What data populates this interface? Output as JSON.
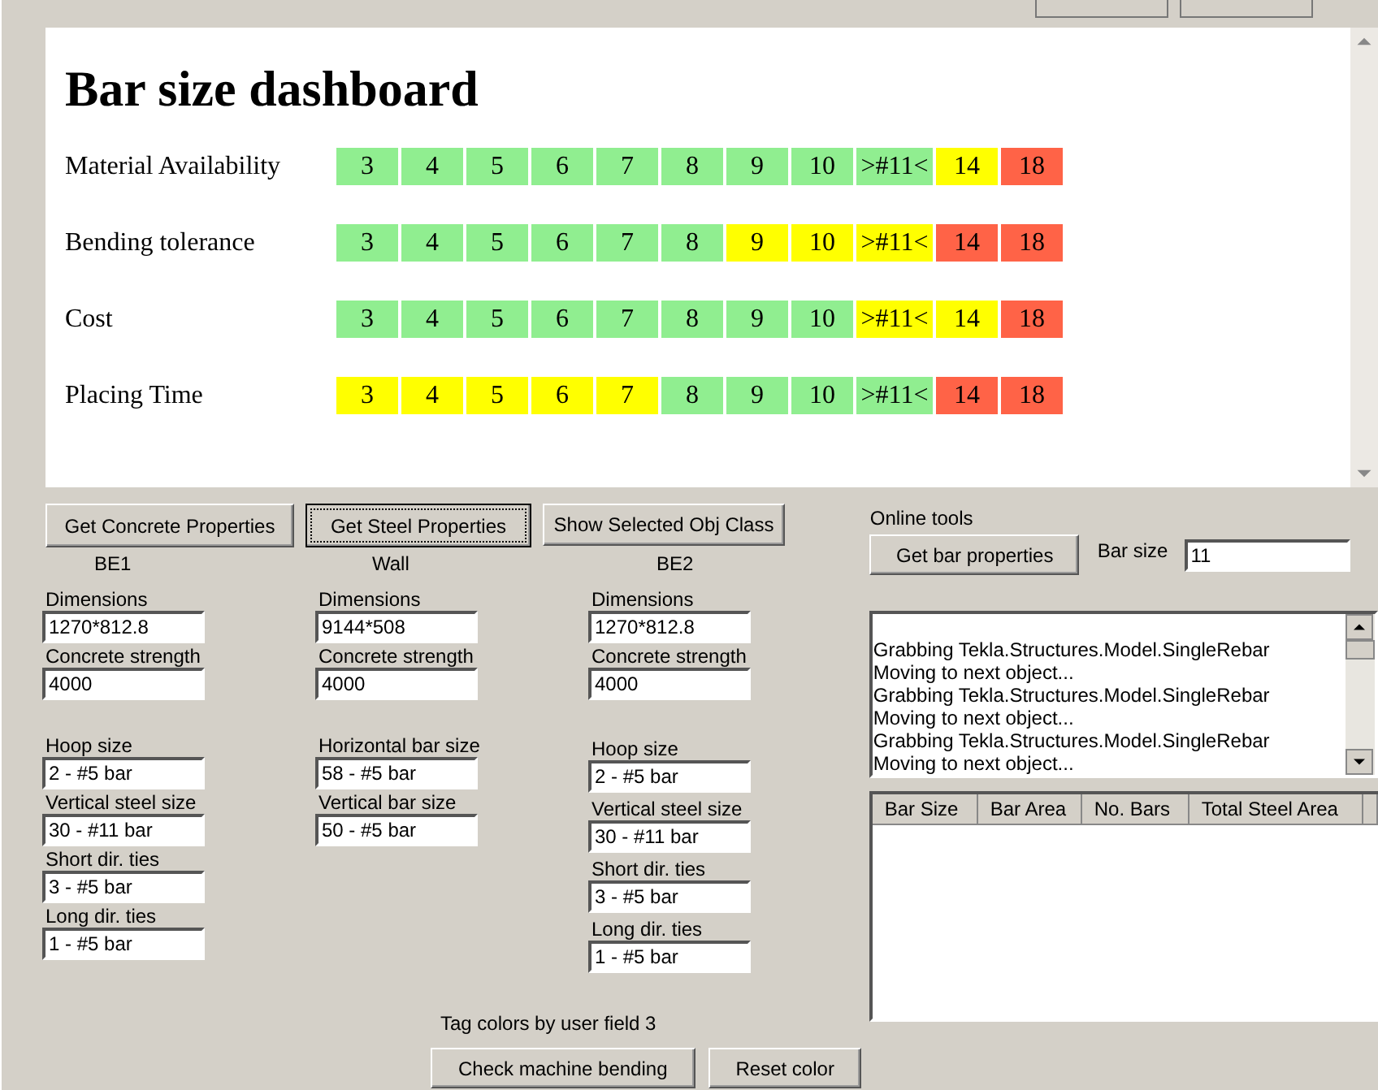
{
  "dashboard": {
    "title": "Bar size dashboard",
    "rows": [
      {
        "label": "Material Availability",
        "cells": [
          {
            "text": "3",
            "color": "#90ee90"
          },
          {
            "text": "4",
            "color": "#90ee90"
          },
          {
            "text": "5",
            "color": "#90ee90"
          },
          {
            "text": "6",
            "color": "#90ee90"
          },
          {
            "text": "7",
            "color": "#90ee90"
          },
          {
            "text": "8",
            "color": "#90ee90"
          },
          {
            "text": "9",
            "color": "#90ee90"
          },
          {
            "text": "10",
            "color": "#90ee90"
          },
          {
            "text": ">#11<",
            "color": "#90ee90"
          },
          {
            "text": "14",
            "color": "#ffff00"
          },
          {
            "text": "18",
            "color": "#ff6347"
          }
        ]
      },
      {
        "label": "Bending tolerance",
        "cells": [
          {
            "text": "3",
            "color": "#90ee90"
          },
          {
            "text": "4",
            "color": "#90ee90"
          },
          {
            "text": "5",
            "color": "#90ee90"
          },
          {
            "text": "6",
            "color": "#90ee90"
          },
          {
            "text": "7",
            "color": "#90ee90"
          },
          {
            "text": "8",
            "color": "#90ee90"
          },
          {
            "text": "9",
            "color": "#ffff00"
          },
          {
            "text": "10",
            "color": "#ffff00"
          },
          {
            "text": ">#11<",
            "color": "#ffff00"
          },
          {
            "text": "14",
            "color": "#ff6347"
          },
          {
            "text": "18",
            "color": "#ff6347"
          }
        ]
      },
      {
        "label": "Cost",
        "cells": [
          {
            "text": "3",
            "color": "#90ee90"
          },
          {
            "text": "4",
            "color": "#90ee90"
          },
          {
            "text": "5",
            "color": "#90ee90"
          },
          {
            "text": "6",
            "color": "#90ee90"
          },
          {
            "text": "7",
            "color": "#90ee90"
          },
          {
            "text": "8",
            "color": "#90ee90"
          },
          {
            "text": "9",
            "color": "#90ee90"
          },
          {
            "text": "10",
            "color": "#90ee90"
          },
          {
            "text": ">#11<",
            "color": "#ffff00"
          },
          {
            "text": "14",
            "color": "#ffff00"
          },
          {
            "text": "18",
            "color": "#ff6347"
          }
        ]
      },
      {
        "label": "Placing Time",
        "cells": [
          {
            "text": "3",
            "color": "#ffff00"
          },
          {
            "text": "4",
            "color": "#ffff00"
          },
          {
            "text": "5",
            "color": "#ffff00"
          },
          {
            "text": "6",
            "color": "#ffff00"
          },
          {
            "text": "7",
            "color": "#ffff00"
          },
          {
            "text": "8",
            "color": "#90ee90"
          },
          {
            "text": "9",
            "color": "#90ee90"
          },
          {
            "text": "10",
            "color": "#90ee90"
          },
          {
            "text": ">#11<",
            "color": "#90ee90"
          },
          {
            "text": "14",
            "color": "#ff6347"
          },
          {
            "text": "18",
            "color": "#ff6347"
          }
        ]
      }
    ]
  },
  "buttons": [
    {
      "label": "Get Concrete Properties",
      "focused": false
    },
    {
      "label": "Get Steel Properties",
      "focused": true
    },
    {
      "label": "Show Selected Obj Class",
      "focused": false
    }
  ],
  "columns": [
    {
      "heading": "BE1",
      "groups": [
        [
          {
            "label": "Dimensions",
            "value": "1270*812.8"
          },
          {
            "label": "Concrete strength",
            "value": "4000"
          }
        ],
        [
          {
            "label": "Hoop size",
            "value": "2 - #5 bar"
          },
          {
            "label": "Vertical steel size",
            "value": "30 - #11 bar"
          },
          {
            "label": "Short dir. ties",
            "value": "3 - #5 bar"
          },
          {
            "label": "Long dir. ties",
            "value": "1 - #5 bar"
          }
        ]
      ]
    },
    {
      "heading": "Wall",
      "groups": [
        [
          {
            "label": "Dimensions",
            "value": "9144*508"
          },
          {
            "label": "Concrete strength",
            "value": "4000"
          }
        ],
        [
          {
            "label": "Horizontal bar size",
            "value": "58 - #5 bar"
          },
          {
            "label": "Vertical bar size",
            "value": "50 - #5 bar"
          }
        ]
      ]
    },
    {
      "heading": "BE2",
      "groups": [
        [
          {
            "label": "Dimensions",
            "value": "1270*812.8"
          },
          {
            "label": "Concrete strength",
            "value": "4000"
          }
        ],
        [
          {
            "label": "Hoop size",
            "value": "2 - #5 bar"
          },
          {
            "label": "Vertical steel size",
            "value": "30 - #11 bar"
          },
          {
            "label": "Short dir. ties",
            "value": "3 - #5 bar"
          },
          {
            "label": "Long dir. ties",
            "value": "1 - #5 bar"
          }
        ]
      ]
    }
  ],
  "tag_colors_label": "Tag colors by user field 3",
  "actions": [
    "Check machine bending",
    "Reset color"
  ],
  "online_tools": {
    "label": "Online tools",
    "button": "Get bar properties",
    "bar_size_label": "Bar size",
    "bar_size_value": "11"
  },
  "log": [
    "Grabbing Tekla.Structures.Model.SingleRebar",
    "Moving to next object...",
    "Grabbing Tekla.Structures.Model.SingleRebar",
    "Moving to next object...",
    "Grabbing Tekla.Structures.Model.SingleRebar",
    "Moving to next object..."
  ],
  "table": {
    "columns": [
      "Bar Size",
      "Bar Area",
      "No. Bars",
      "Total Steel Area"
    ]
  }
}
